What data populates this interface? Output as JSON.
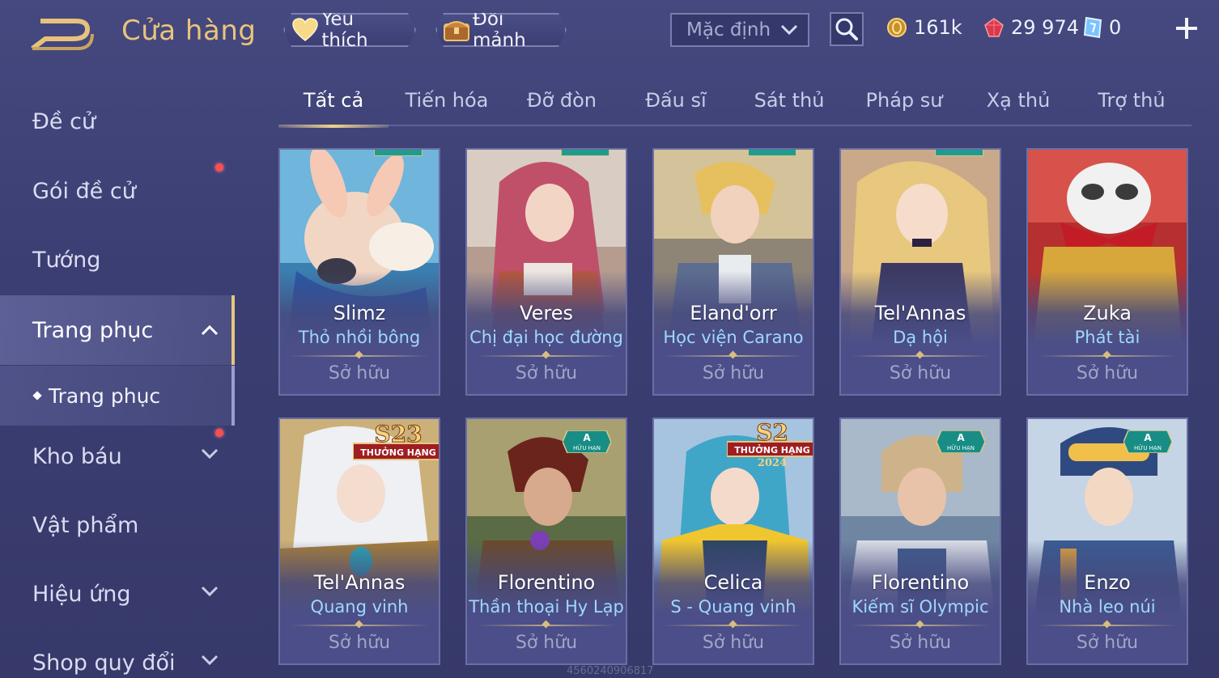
{
  "header": {
    "title": "Cửa hàng",
    "favorites_label": "Yêu thích",
    "shard_label": "Đổi mảnh",
    "sort_value": "Mặc định",
    "gold": "161k",
    "gems": "29 974",
    "vouchers": "0"
  },
  "sidebar": {
    "items": [
      {
        "label": "Đề cử"
      },
      {
        "label": "Gói đề cử"
      },
      {
        "label": "Tướng"
      },
      {
        "label": "Trang phục"
      },
      {
        "label": "Kho báu"
      },
      {
        "label": "Vật phẩm"
      },
      {
        "label": "Hiệu ứng"
      },
      {
        "label": "Shop quy đổi"
      }
    ],
    "sub_item": "Trang phục"
  },
  "tabs": [
    "Tất cả",
    "Tiến hóa",
    "Đỡ đòn",
    "Đấu sĩ",
    "Sát thủ",
    "Pháp sư",
    "Xạ thủ",
    "Trợ thủ"
  ],
  "cards": [
    {
      "name": "Slimz",
      "skin": "Thỏ nhồi bông",
      "status": "Sở hữu"
    },
    {
      "name": "Veres",
      "skin": "Chị đại học đường",
      "status": "Sở hữu"
    },
    {
      "name": "Eland'orr",
      "skin": "Học viện Carano",
      "status": "Sở hữu"
    },
    {
      "name": "Tel'Annas",
      "skin": "Dạ hội",
      "status": "Sở hữu"
    },
    {
      "name": "Zuka",
      "skin": "Phát tài",
      "status": "Sở hữu"
    },
    {
      "name": "Tel'Annas",
      "skin": "Quang vinh",
      "status": "Sở hữu"
    },
    {
      "name": "Florentino",
      "skin": "Thần thoại Hy Lạp",
      "status": "Sở hữu"
    },
    {
      "name": "Celica",
      "skin": "S - Quang vinh",
      "status": "Sở hữu"
    },
    {
      "name": "Florentino",
      "skin": "Kiếm sĩ Olympic",
      "status": "Sở hữu"
    },
    {
      "name": "Enzo",
      "skin": "Nhà leo núi",
      "status": "Sở hữu"
    }
  ],
  "badges": {
    "a_letter": "A",
    "limited": "HỮU HẠN",
    "season_rank": "THƯỞNG HẠNG",
    "s23": "S23",
    "s2": "S2",
    "year": "2024"
  },
  "watermark": "4560240906817",
  "colors": {
    "accent_gold": "#e9c47a",
    "skin_name_blue": "#9fd8ff",
    "notify_red": "#ff4d4d"
  }
}
